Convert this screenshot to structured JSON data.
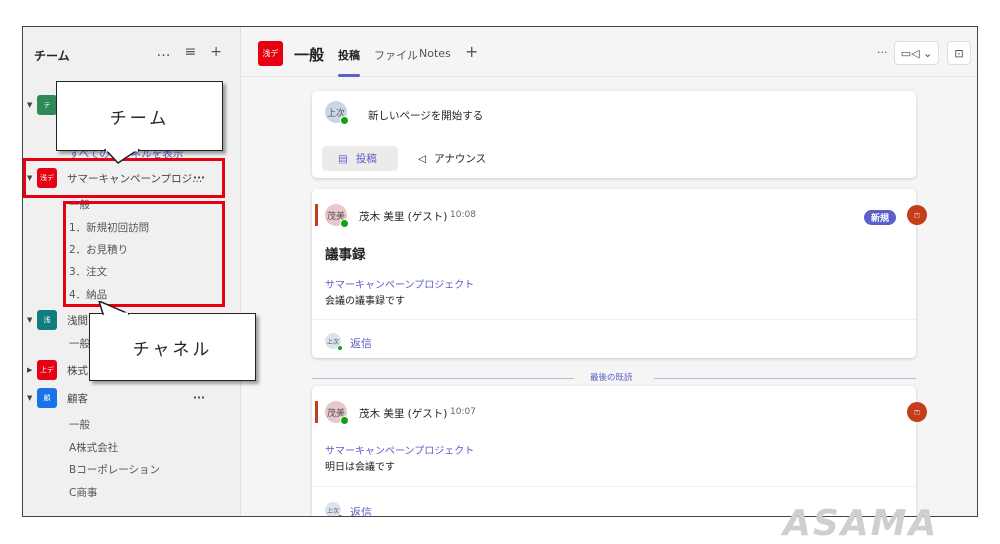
{
  "sidebar": {
    "title": "チーム",
    "icons": {
      "more": "…",
      "filter": "≡",
      "add": "+"
    },
    "show_all_channels": "すべてのチャネルを表示",
    "teams": [
      {
        "avatar": "テ",
        "color": "#2e8b57",
        "name": ""
      },
      {
        "avatar": "浅デ",
        "color": "#e60012",
        "name": "サマーキャンペーンプロジ...",
        "more": "···",
        "channels": [
          "一般",
          "1．新規初回訪問",
          "2．お見積り",
          "3．注文",
          "4．納品"
        ]
      },
      {
        "avatar": "浅",
        "color": "#117d7d",
        "name": "浅間",
        "channels": [
          "一般"
        ]
      },
      {
        "avatar": "上デ",
        "color": "#e60012",
        "name": "株式"
      },
      {
        "avatar": "顧",
        "color": "#1a73e8",
        "name": "顧客",
        "more": "···",
        "channels": [
          "一般",
          "A株式会社",
          "Bコーポレーション",
          "C商事"
        ]
      }
    ]
  },
  "callouts": {
    "team": "チーム",
    "channel": "チャネル"
  },
  "header": {
    "avatar": "浅デ",
    "title": "一般",
    "tabs": [
      "投稿",
      "ファイル",
      "Notes"
    ],
    "add": "+",
    "more": "···",
    "video": "▭◁",
    "chevron": "⌄",
    "panel": "⊡"
  },
  "compose": {
    "avatar": "上次",
    "placeholder": "新しいページを開始する",
    "post_label": "投稿",
    "announce_label": "アナウンス"
  },
  "posts": [
    {
      "avatar": "茂美",
      "author": "茂木 美里 (ゲスト)",
      "time": "10:08",
      "badge": "新規",
      "title": "議事録",
      "link": "サマーキャンペーンプロジェクト",
      "body": "会議の議事録です",
      "reply_avatar": "上次",
      "reply": "返信"
    },
    {
      "avatar": "茂美",
      "author": "茂木 美里 (ゲスト)",
      "time": "10:07",
      "link": "サマーキャンペーンプロジェクト",
      "body": "明日は会議です",
      "reply_avatar": "上次",
      "reply": "返信"
    }
  ],
  "last_read": "最後の既読",
  "watermark": "ASAMA",
  "colors": {
    "accent": "#5b5fc7",
    "highlight": "#e60012"
  }
}
